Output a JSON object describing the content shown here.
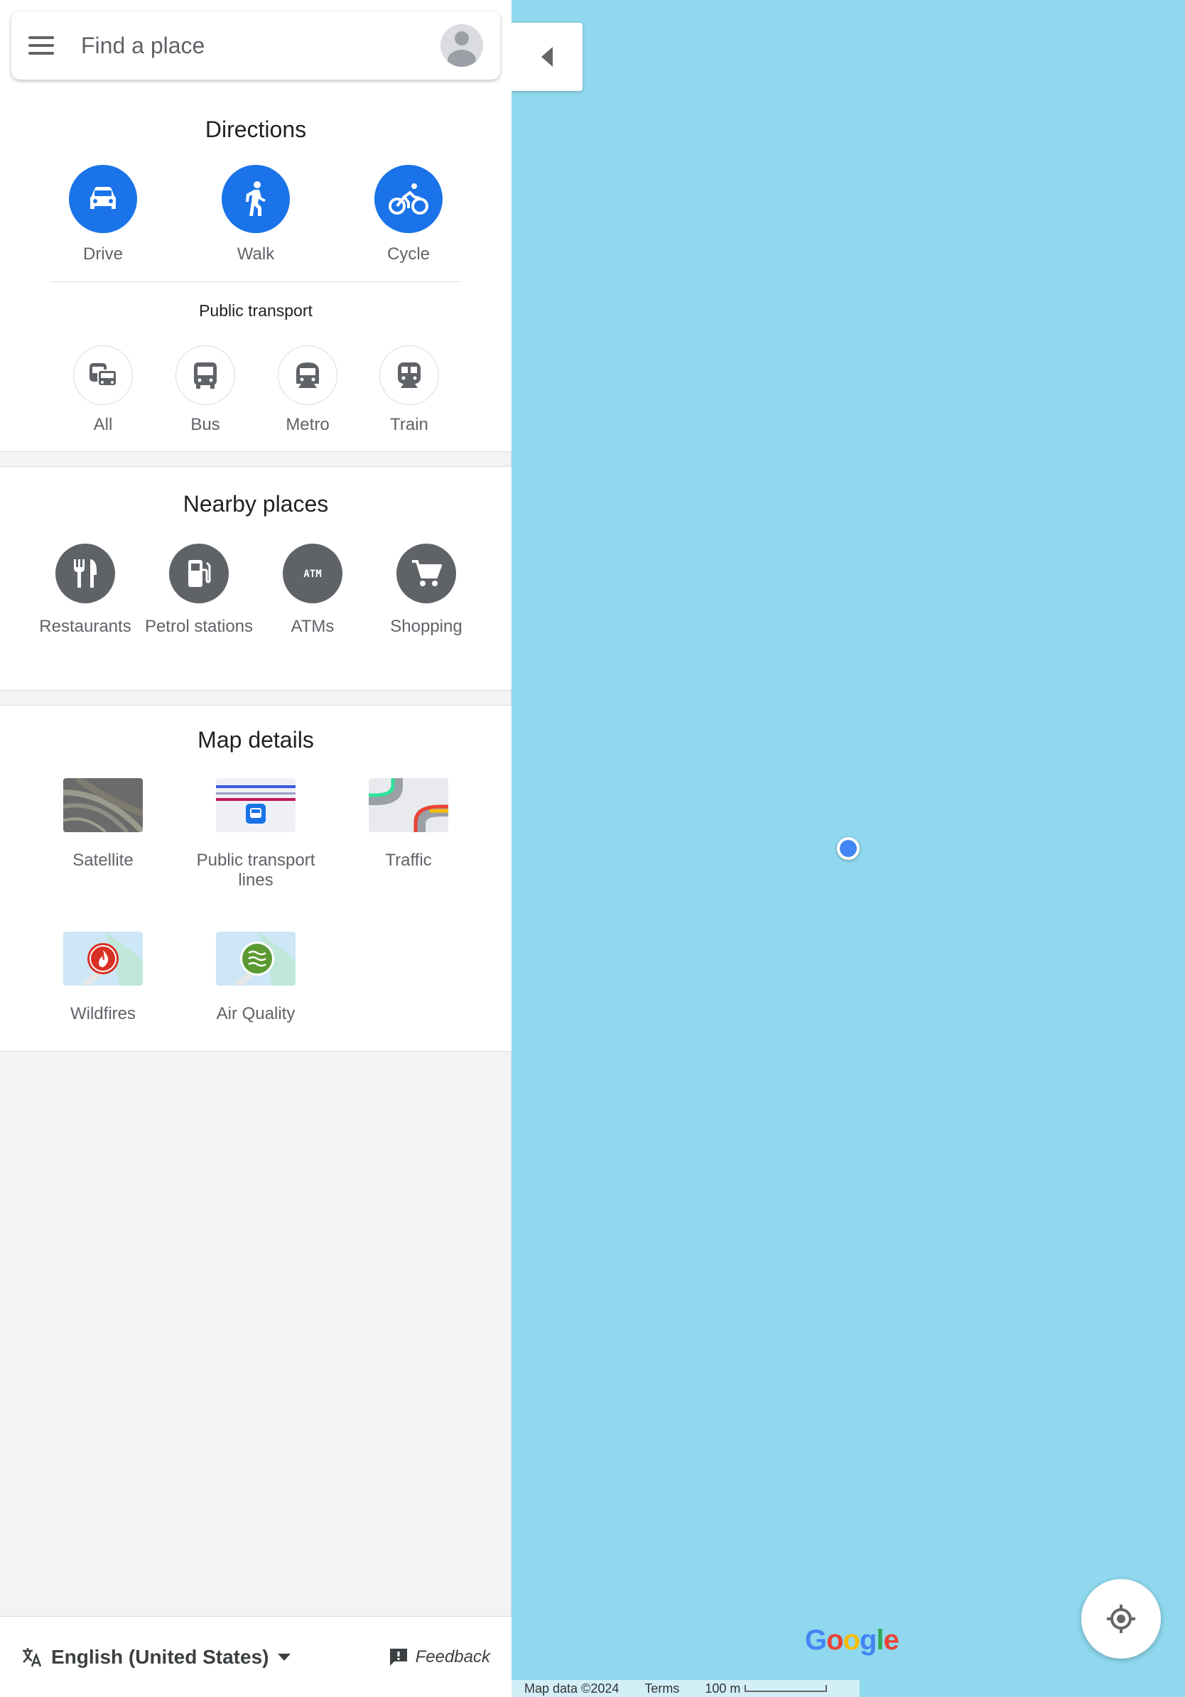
{
  "search": {
    "placeholder": "Find a place"
  },
  "directions": {
    "title": "Directions",
    "modes": [
      {
        "label": "Drive",
        "icon": "car-icon"
      },
      {
        "label": "Walk",
        "icon": "walk-icon"
      },
      {
        "label": "Cycle",
        "icon": "bicycle-icon"
      }
    ],
    "transit_title": "Public transport",
    "transit": [
      {
        "label": "All",
        "icon": "transit-all-icon"
      },
      {
        "label": "Bus",
        "icon": "bus-icon"
      },
      {
        "label": "Metro",
        "icon": "metro-icon"
      },
      {
        "label": "Train",
        "icon": "train-icon"
      }
    ]
  },
  "nearby": {
    "title": "Nearby places",
    "items": [
      {
        "label": "Restaurants",
        "icon": "restaurant-icon"
      },
      {
        "label": "Petrol stations",
        "icon": "fuel-icon"
      },
      {
        "label": "ATMs",
        "icon": "atm-icon"
      },
      {
        "label": "Shopping",
        "icon": "shopping-cart-icon"
      }
    ]
  },
  "map_details": {
    "title": "Map details",
    "layers": [
      {
        "label": "Satellite"
      },
      {
        "label": "Public transport lines"
      },
      {
        "label": "Traffic"
      },
      {
        "label": "Wildfires"
      },
      {
        "label": "Air Quality"
      }
    ]
  },
  "footer": {
    "language": "English (United States)",
    "feedback": "Feedback"
  },
  "map": {
    "logo": "Google",
    "attribution": "Map data ©2024",
    "terms": "Terms",
    "scale": "100 m"
  },
  "colors": {
    "accent": "#1a73e8",
    "water": "#8fd8ee",
    "location_dot": "#4285f4"
  }
}
